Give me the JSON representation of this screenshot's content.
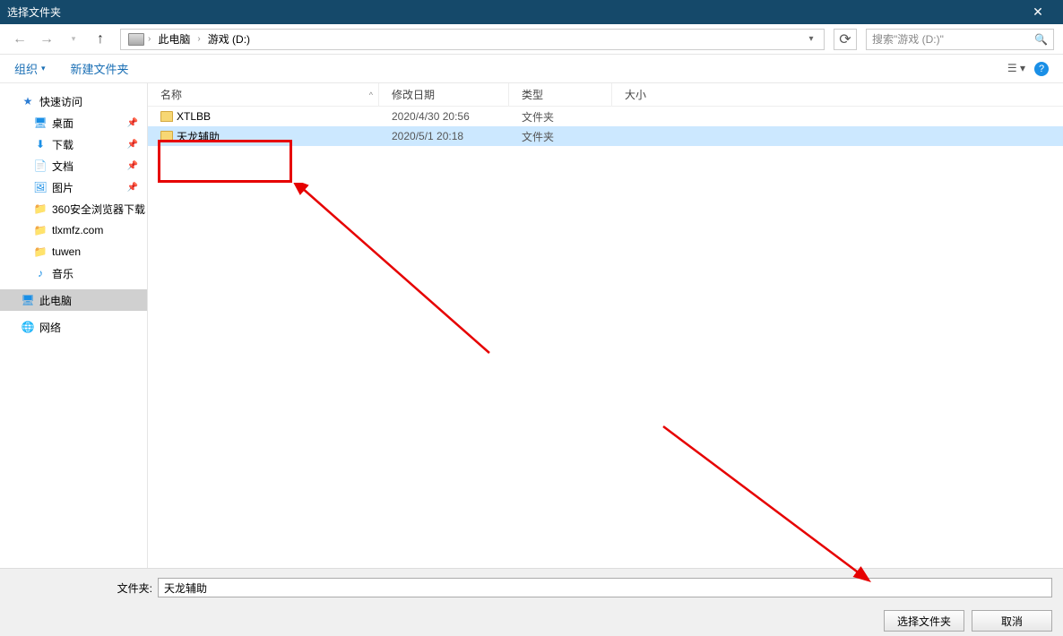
{
  "title": "选择文件夹",
  "breadcrumb": {
    "root": "此电脑",
    "current": "游戏 (D:)"
  },
  "search": {
    "placeholder": "搜索\"游戏 (D:)\""
  },
  "toolbar": {
    "organize": "组织",
    "newfolder": "新建文件夹"
  },
  "columns": {
    "name": "名称",
    "date": "修改日期",
    "type": "类型",
    "size": "大小"
  },
  "sidebar": {
    "quick": "快速访问",
    "items": [
      {
        "label": "桌面",
        "icon": "desktop",
        "pinned": true
      },
      {
        "label": "下载",
        "icon": "down",
        "pinned": true
      },
      {
        "label": "文档",
        "icon": "doc",
        "pinned": true
      },
      {
        "label": "图片",
        "icon": "pic",
        "pinned": true
      },
      {
        "label": "360安全浏览器下载",
        "icon": "fold",
        "pinned": false
      },
      {
        "label": "tlxmfz.com",
        "icon": "fold",
        "pinned": false
      },
      {
        "label": "tuwen",
        "icon": "fold",
        "pinned": false
      },
      {
        "label": "音乐",
        "icon": "note",
        "pinned": false
      }
    ],
    "pc": "此电脑",
    "network": "网络"
  },
  "rows": [
    {
      "name": "XTLBB",
      "date": "2020/4/30 20:56",
      "type": "文件夹",
      "selected": false
    },
    {
      "name": "天龙辅助",
      "date": "2020/5/1 20:18",
      "type": "文件夹",
      "selected": true
    }
  ],
  "footer": {
    "label": "文件夹:",
    "value": "天龙辅助",
    "ok": "选择文件夹",
    "cancel": "取消"
  }
}
